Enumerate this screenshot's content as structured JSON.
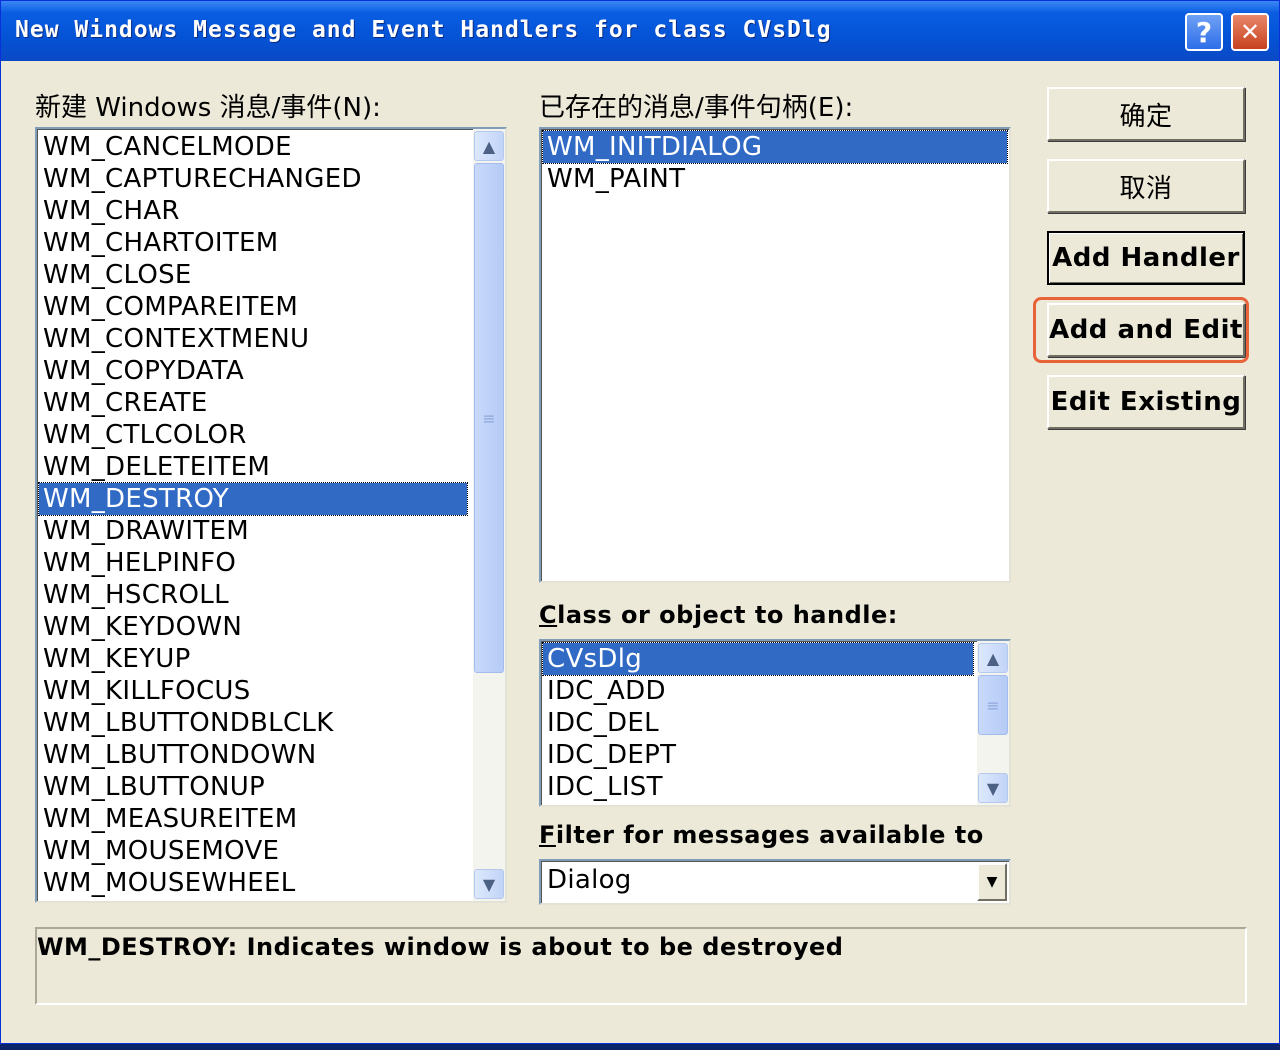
{
  "window": {
    "title": "New Windows Message and Event Handlers for class CVsDlg",
    "help_glyph": "?",
    "close_glyph": "✕"
  },
  "new_messages": {
    "label": "新建 Windows 消息/事件(N):",
    "items": [
      "WM_CANCELMODE",
      "WM_CAPTURECHANGED",
      "WM_CHAR",
      "WM_CHARTOITEM",
      "WM_CLOSE",
      "WM_COMPAREITEM",
      "WM_CONTEXTMENU",
      "WM_COPYDATA",
      "WM_CREATE",
      "WM_CTLCOLOR",
      "WM_DELETEITEM",
      "WM_DESTROY",
      "WM_DRAWITEM",
      "WM_HELPINFO",
      "WM_HSCROLL",
      "WM_KEYDOWN",
      "WM_KEYUP",
      "WM_KILLFOCUS",
      "WM_LBUTTONDBLCLK",
      "WM_LBUTTONDOWN",
      "WM_LBUTTONUP",
      "WM_MEASUREITEM",
      "WM_MOUSEMOVE",
      "WM_MOUSEWHEEL"
    ],
    "selected": "WM_DESTROY"
  },
  "existing_handlers": {
    "label": "已存在的消息/事件句柄(E):",
    "items": [
      "WM_INITDIALOG",
      "WM_PAINT"
    ],
    "selected": "WM_INITDIALOG"
  },
  "class_to_handle": {
    "label": "Class or object to handle:",
    "items": [
      "CVsDlg",
      "IDC_ADD",
      "IDC_DEL",
      "IDC_DEPT",
      "IDC_LIST"
    ],
    "selected": "CVsDlg"
  },
  "filter": {
    "label": "Filter for messages available to",
    "value": "Dialog"
  },
  "buttons": {
    "ok": "确定",
    "cancel": "取消",
    "add_handler": "Add Handler",
    "add_and_edit": "Add and Edit",
    "edit_existing": "Edit Existing"
  },
  "description": "WM_DESTROY:  Indicates window is about to be destroyed",
  "colors": {
    "selection": "#316ac5",
    "highlight_box": "#e8623a",
    "dialog_bg": "#ece9d8"
  }
}
